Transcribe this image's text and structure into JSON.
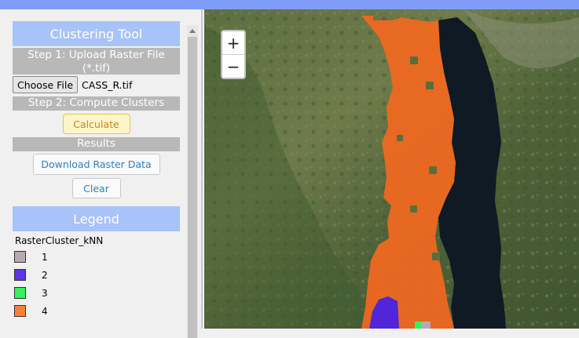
{
  "panel": {
    "title": "Clustering Tool",
    "step1": "Step 1: Upload Raster File (*.tif)",
    "choose_file_label": "Choose File",
    "file_name": "CASS_R.tif",
    "step2": "Step 2: Compute Clusters",
    "calculate_label": "Calculate",
    "results_heading": "Results",
    "download_label": "Download Raster Data",
    "clear_label": "Clear"
  },
  "legend": {
    "title": "Legend",
    "layer_name": "RasterCluster_kNN",
    "items": [
      {
        "label": "1",
        "color": "#b8a9b6"
      },
      {
        "label": "2",
        "color": "#5b35e6"
      },
      {
        "label": "3",
        "color": "#32f45a"
      },
      {
        "label": "4",
        "color": "#fb7f3a"
      }
    ]
  },
  "map": {
    "zoom_in_label": "+",
    "zoom_out_label": "−",
    "cluster_color": "#f3681f",
    "cluster2_color": "#5026d8",
    "lake_color": "#0f1a24"
  },
  "colors": {
    "header_accent": "#7f9df7",
    "panel_title_bg": "#a8c2fa",
    "step_bg": "#b8b8b8"
  }
}
